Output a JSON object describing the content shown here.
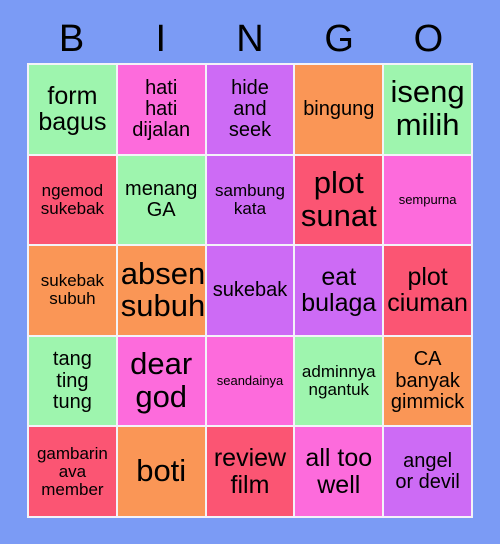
{
  "background_color": "#7b9bf5",
  "grid_line_color": "#f3f3f8",
  "text_color": "#000000",
  "header": {
    "letters": [
      "B",
      "I",
      "N",
      "G",
      "O"
    ]
  },
  "palette": {
    "green": "#9ef5ae",
    "pink": "#fd6bdc",
    "purple": "#cd6bf5",
    "orange": "#fa9656",
    "crimson": "#fb5573"
  },
  "grid": {
    "columns": 5,
    "rows": 5,
    "cells": [
      {
        "text": "form\nbagus",
        "color": "#9ef5ae",
        "size": "lg"
      },
      {
        "text": "hati\nhati\ndijalan",
        "color": "#fd6bdc",
        "size": "md"
      },
      {
        "text": "hide\nand\nseek",
        "color": "#cd6bf5",
        "size": "md"
      },
      {
        "text": "bingung",
        "color": "#fa9656",
        "size": "md"
      },
      {
        "text": "iseng\nmilih",
        "color": "#9ef5ae",
        "size": "xl"
      },
      {
        "text": "ngemod\nsukebak",
        "color": "#fb5573",
        "size": "sm"
      },
      {
        "text": "menang\nGA",
        "color": "#9ef5ae",
        "size": "md"
      },
      {
        "text": "sambung\nkata",
        "color": "#cd6bf5",
        "size": "sm"
      },
      {
        "text": "plot\nsunat",
        "color": "#fb5573",
        "size": "xl"
      },
      {
        "text": "sempurna",
        "color": "#fd6bdc",
        "size": "xs"
      },
      {
        "text": "sukebak\nsubuh",
        "color": "#fa9656",
        "size": "sm"
      },
      {
        "text": "absen\nsubuh",
        "color": "#fa9656",
        "size": "xl"
      },
      {
        "text": "sukebak",
        "color": "#cd6bf5",
        "size": "md"
      },
      {
        "text": "eat\nbulaga",
        "color": "#cd6bf5",
        "size": "lg"
      },
      {
        "text": "plot\nciuman",
        "color": "#fb5573",
        "size": "lg"
      },
      {
        "text": "tang\nting\ntung",
        "color": "#9ef5ae",
        "size": "md"
      },
      {
        "text": "dear\ngod",
        "color": "#fd6bdc",
        "size": "xl"
      },
      {
        "text": "seandainya",
        "color": "#fd6bdc",
        "size": "xs"
      },
      {
        "text": "adminnya\nngantuk",
        "color": "#9ef5ae",
        "size": "sm"
      },
      {
        "text": "CA\nbanyak\ngimmick",
        "color": "#fa9656",
        "size": "md"
      },
      {
        "text": "gambarin\nava\nmember",
        "color": "#fb5573",
        "size": "sm"
      },
      {
        "text": "boti",
        "color": "#fa9656",
        "size": "xl"
      },
      {
        "text": "review\nfilm",
        "color": "#fb5573",
        "size": "lg"
      },
      {
        "text": "all too\nwell",
        "color": "#fd6bdc",
        "size": "lg"
      },
      {
        "text": "angel\nor devil",
        "color": "#cd6bf5",
        "size": "md"
      }
    ]
  }
}
